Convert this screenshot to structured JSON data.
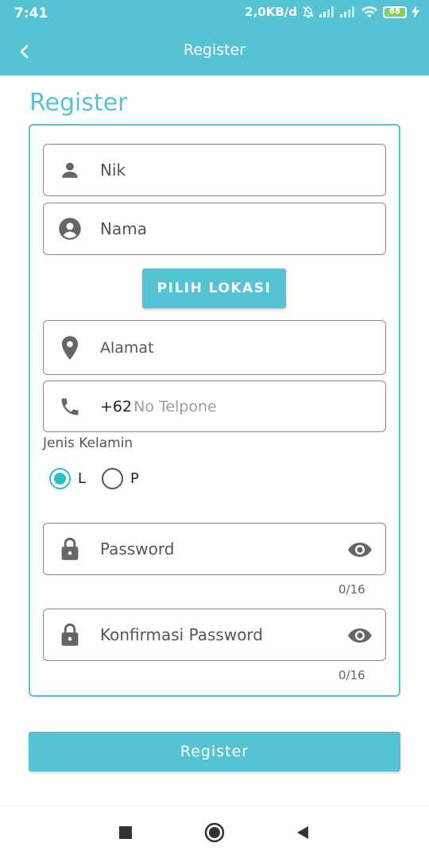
{
  "statusbar": {
    "time": "7:41",
    "net_speed": "2,0KB/d",
    "battery": "88"
  },
  "appbar": {
    "title": "Register"
  },
  "page": {
    "heading": "Register"
  },
  "form": {
    "nik_label": "Nik",
    "nama_label": "Nama",
    "pilih_lokasi_button": "PILIH LOKASI",
    "alamat_label": "Alamat",
    "phone_prefix": "+62",
    "phone_placeholder": "No Telpone",
    "gender_label": "Jenis Kelamin",
    "gender_options": [
      {
        "label": "L",
        "selected": true
      },
      {
        "label": "P",
        "selected": false
      }
    ],
    "password_label": "Password",
    "password_counter": "0/16",
    "confirm_label": "Konfirmasi Password",
    "confirm_counter": "0/16",
    "register_button": "Register"
  },
  "colors": {
    "accent": "#56c3d4",
    "radio": "#2bbfc6"
  }
}
